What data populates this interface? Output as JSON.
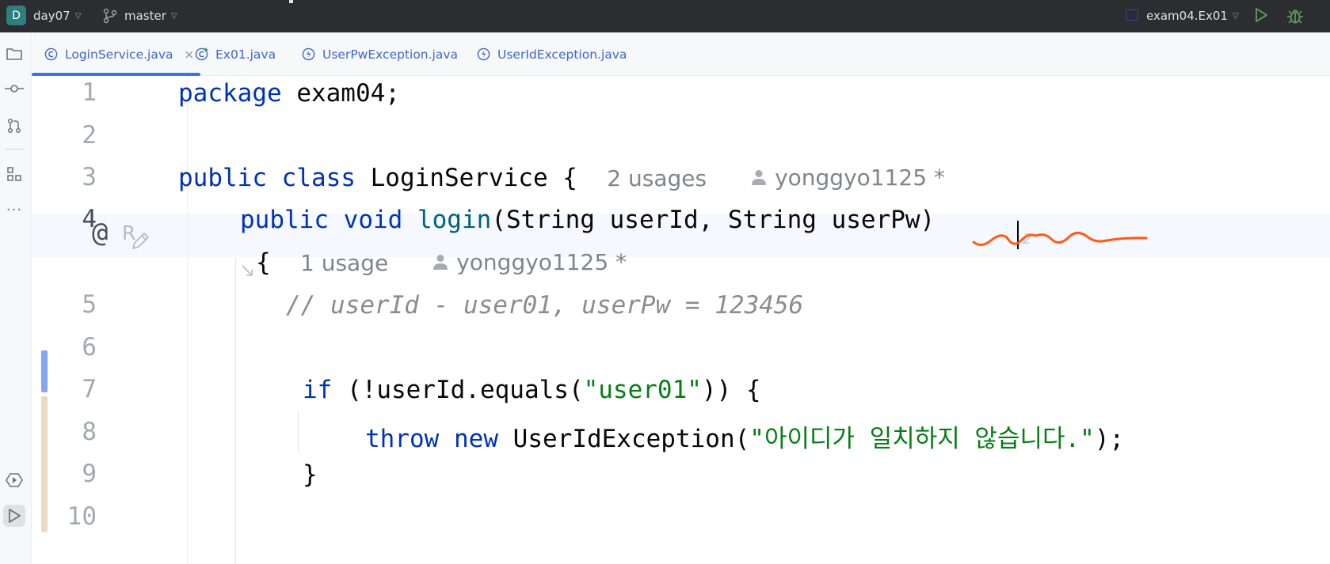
{
  "titlebar": {
    "project_badge": "D",
    "project_name": "day07",
    "branch": "master",
    "run_config": "exam04.Ex01",
    "icons": [
      "branch-icon",
      "chevron-down-icon",
      "run-icon",
      "debug-icon"
    ]
  },
  "tabs": [
    {
      "label": "LoginService.java",
      "icon": "class-icon",
      "close": "×",
      "active": true
    },
    {
      "label": "Ex01.java",
      "icon": "runnable-class-icon",
      "active": false
    },
    {
      "label": "UserPwException.java",
      "icon": "exception-class-icon",
      "active": false
    },
    {
      "label": "UserIdException.java",
      "icon": "exception-class-icon",
      "active": false
    }
  ],
  "toolstrip": [
    "folder-icon",
    "commit-icon",
    "pull-request-icon",
    "structure-icon",
    "more-icon",
    "services-icon",
    "run-icon"
  ],
  "gutter": {
    "line_numbers": [
      "1",
      "2",
      "3",
      "4",
      "5",
      "6",
      "7",
      "8",
      "9",
      "10"
    ],
    "current_line": "4",
    "line4_marker": "@",
    "line4_marker2": "R"
  },
  "code": {
    "l1": {
      "kw": "package",
      "rest": " exam04;"
    },
    "l3": {
      "kw1": "public",
      "kw2": "class",
      "rest": " LoginService {",
      "usages": "2 usages",
      "author": "yonggyo1125 *"
    },
    "l4": {
      "kw1": "public",
      "kw2": "void",
      "fn": "login",
      "rest": "(String userId, String userPw) ",
      "caret_hint": "2"
    },
    "l4b": {
      "brace": "{",
      "usages": "1 usage",
      "author": "yonggyo1125 *"
    },
    "l5": {
      "comment": "// userId - user01, userPw = 123456"
    },
    "l7": {
      "kw": "if",
      "pre": " (!userId.equals(",
      "str": "\"user01\"",
      "post": ")) {"
    },
    "l8": {
      "kw1": "throw",
      "kw2": "new",
      "cls": " UserIdException(",
      "str": "\"아이디가 일치하지 않습니다.\"",
      "post": ");"
    },
    "l9": {
      "brace": "}"
    }
  },
  "colors": {
    "keyword": "#0033b3",
    "function": "#00627a",
    "string": "#067d17",
    "comment": "#8c8c8c",
    "annotation_scribble": "#ff5a14"
  }
}
